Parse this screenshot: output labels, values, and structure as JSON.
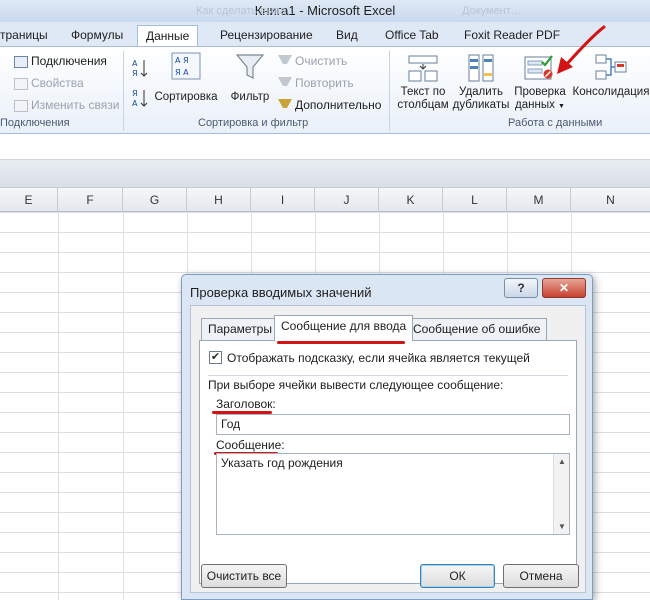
{
  "window": {
    "title": "Книга1  -  Microsoft Excel",
    "ghost_left": "Как сделать выпа…",
    "ghost_right": "Документ…"
  },
  "ribbon_tabs": [
    "траницы",
    "Формулы",
    "Данные",
    "Рецензирование",
    "Вид",
    "Office Tab",
    "Foxit Reader PDF"
  ],
  "connections": {
    "items": [
      "Подключения",
      "Свойства",
      "Изменить связи"
    ],
    "group_label": "Подключения"
  },
  "sort_filter": {
    "sort_label": "Сортировка",
    "filter_label": "Фильтр",
    "clear_label": "Очистить",
    "reapply_label": "Повторить",
    "advanced_label": "Дополнительно",
    "group_label": "Сортировка и фильтр"
  },
  "data_tools": {
    "text_to_columns": [
      "Текст по",
      "столбцам"
    ],
    "remove_duplicates": [
      "Удалить",
      "дубликаты"
    ],
    "data_validation": [
      "Проверка",
      "данных"
    ],
    "consolidation": "Консолидация",
    "group_label": "Работа с данными"
  },
  "columns": [
    "E",
    "F",
    "G",
    "H",
    "I",
    "J",
    "K",
    "L",
    "M",
    "N"
  ],
  "dialog": {
    "title": "Проверка вводимых значений",
    "help": "?",
    "tabs": [
      "Параметры",
      "Сообщение для ввода",
      "Сообщение об ошибке"
    ],
    "show_hint_label": "Отображать подсказку, если ячейка является текущей",
    "show_hint_checked": true,
    "on_select_label": "При выборе ячейки вывести следующее сообщение:",
    "title_label": "Заголовок:",
    "title_value": "Год",
    "message_label": "Сообщение:",
    "message_value": "Указать год рождения",
    "clear_all": "Очистить все",
    "ok": "ОК",
    "cancel": "Отмена"
  },
  "colors": {
    "annotation_red": "#d21414",
    "ribbon_blue": "#dfe9f5"
  }
}
